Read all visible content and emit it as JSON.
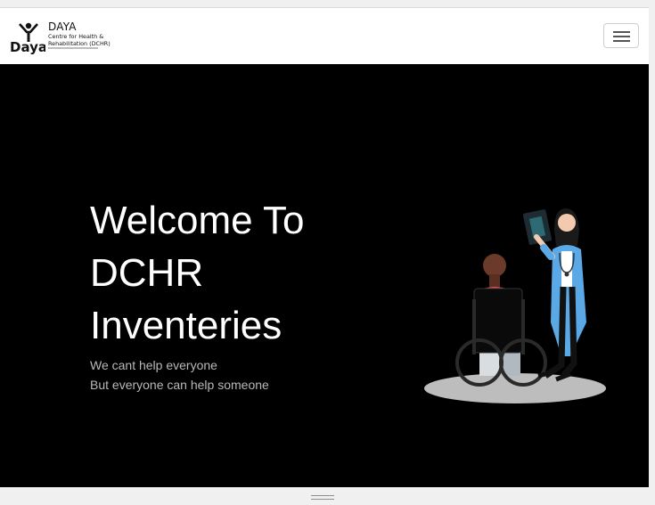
{
  "brand": {
    "title": "DAYA",
    "subtitle_line1": "Centre for Health &",
    "subtitle_line2": "Rehabilitation (DCHR)",
    "logo_text": "Daya"
  },
  "nav": {
    "toggler_icon": "hamburger-icon"
  },
  "hero": {
    "headline_lines": [
      "Welcome To",
      "DCHR",
      "Inventeries"
    ],
    "tagline_lines": [
      "We cant help everyone",
      "But everyone can help someone"
    ],
    "illustration": "doctor-patient-wheelchair-illustration"
  },
  "colors": {
    "hero_bg": "#000000",
    "headline": "#ffffff",
    "tagline": "#b9b9b9",
    "coat": "#5aa9e6",
    "shirt": "#d9555f",
    "floor": "#bdbdbd"
  }
}
